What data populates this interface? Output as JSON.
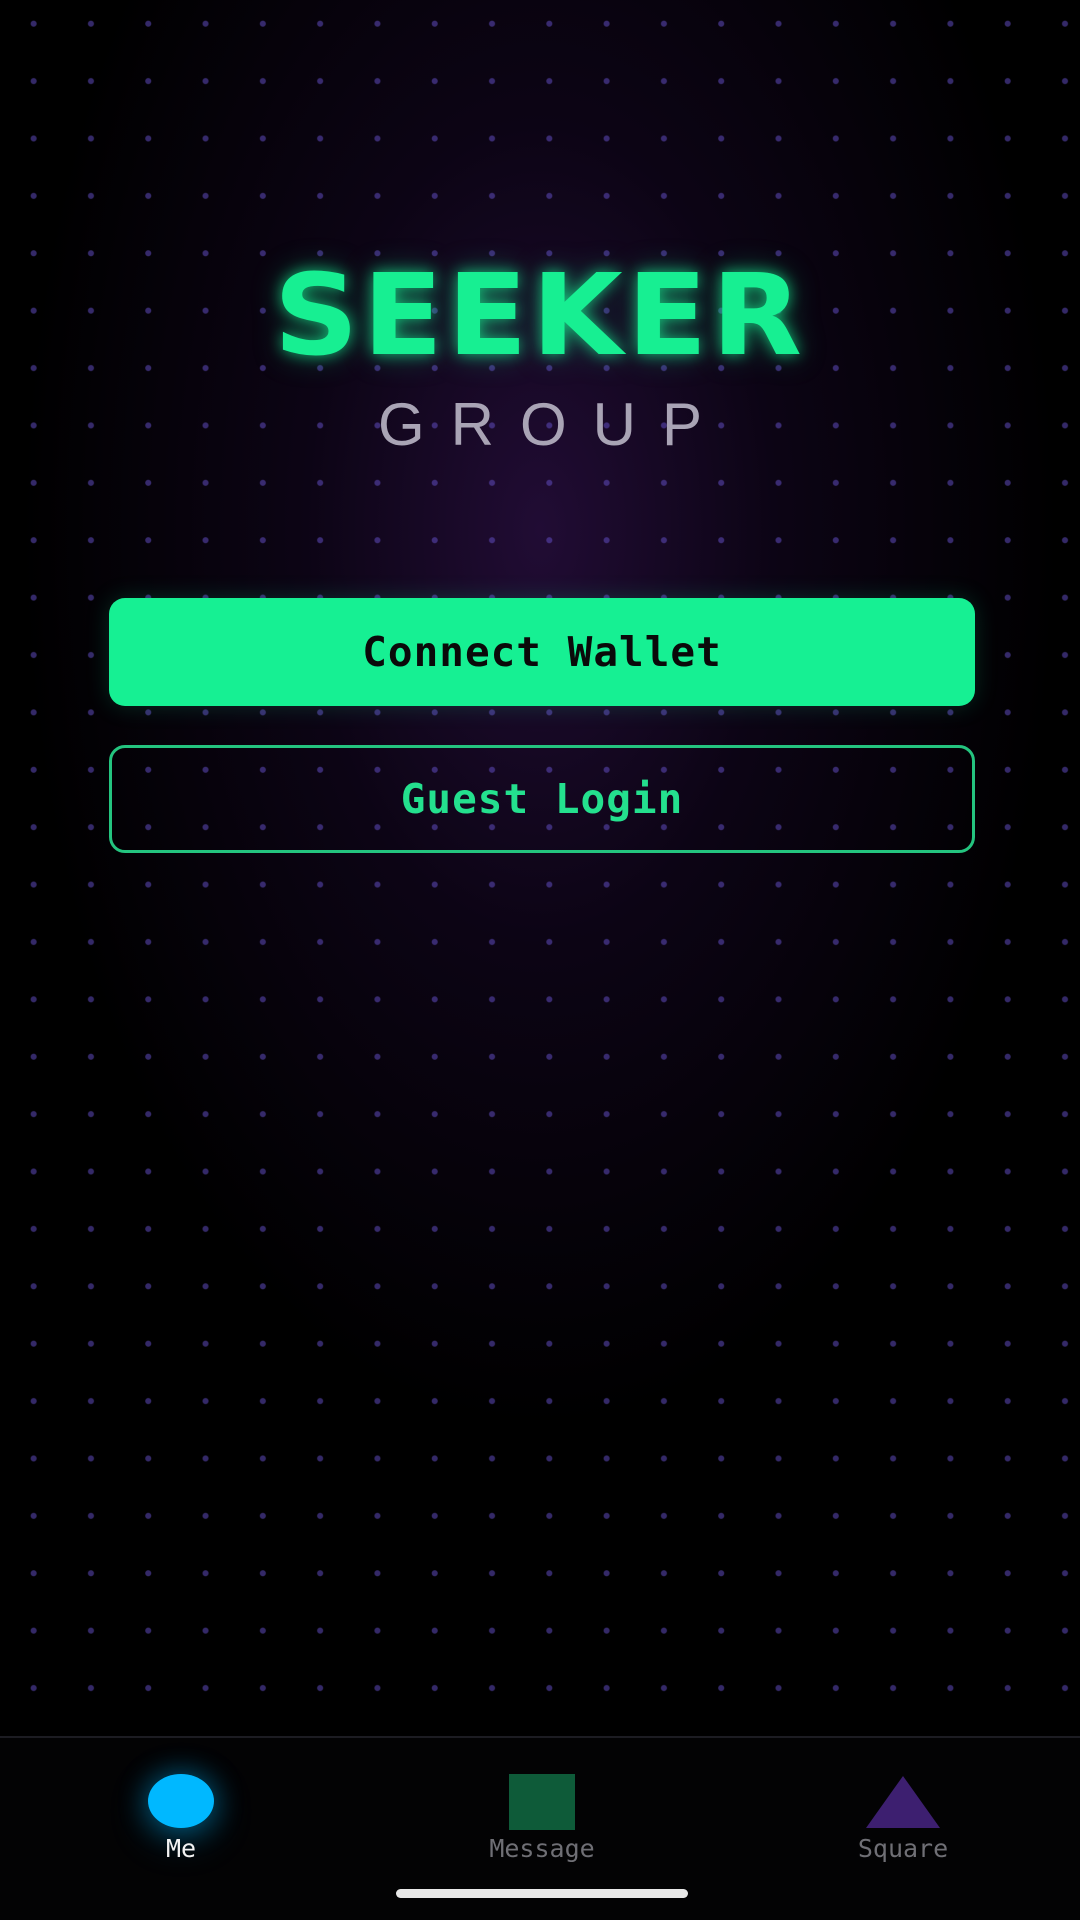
{
  "brand": {
    "title": "SEEKER",
    "subtitle": "GROUP"
  },
  "actions": {
    "connect_wallet": "Connect Wallet",
    "guest_login": "Guest Login"
  },
  "tabbar": {
    "active": "Me",
    "tabs": [
      {
        "label": "Me",
        "icon": "circle-icon",
        "color": "#00b8ff"
      },
      {
        "label": "Message",
        "icon": "square-icon",
        "color": "#0e5b39"
      },
      {
        "label": "Square",
        "icon": "triangle-icon",
        "color": "#3d1f70"
      }
    ]
  },
  "colors": {
    "accent": "#16f093",
    "background": "#000000"
  }
}
